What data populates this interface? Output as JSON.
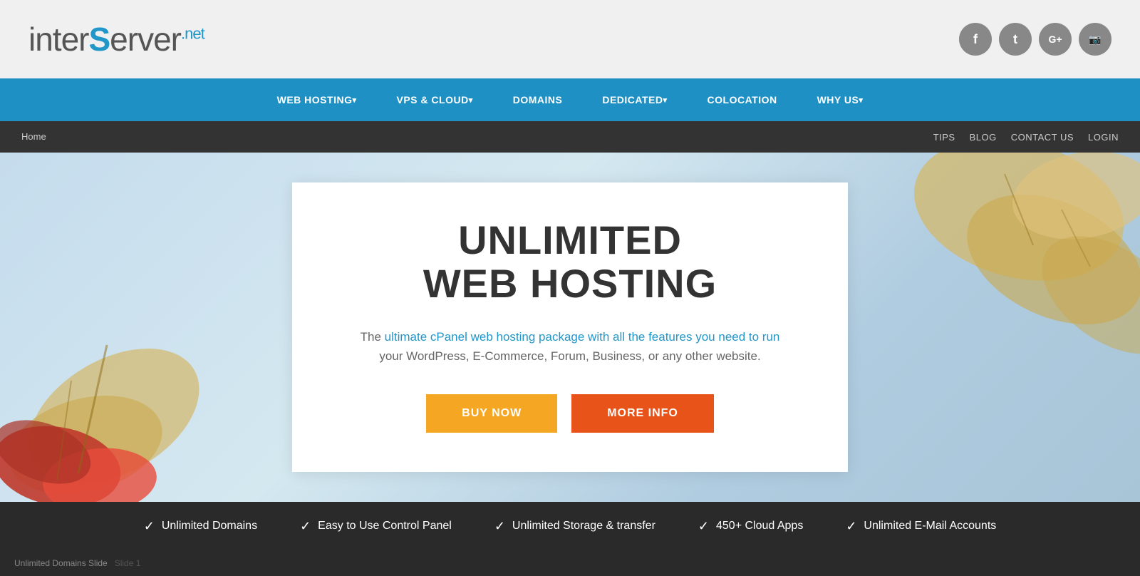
{
  "header": {
    "logo_inter": "inter",
    "logo_s": "S",
    "logo_erver": "erver",
    "logo_net": ".net"
  },
  "social": {
    "facebook": "f",
    "twitter": "t",
    "googleplus": "G+",
    "instagram": "📷"
  },
  "primary_nav": {
    "items": [
      {
        "label": "WEB HOSTING",
        "has_arrow": true
      },
      {
        "label": "VPS & CLOUD",
        "has_arrow": true
      },
      {
        "label": "DOMAINS",
        "has_arrow": false
      },
      {
        "label": "DEDICATED",
        "has_arrow": true
      },
      {
        "label": "COLOCATION",
        "has_arrow": false
      },
      {
        "label": "WHY US",
        "has_arrow": true
      }
    ]
  },
  "secondary_nav": {
    "home": "Home",
    "right_links": [
      "TIPS",
      "BLOG",
      "CONTACT US",
      "LOGIN"
    ]
  },
  "hero": {
    "title_line1": "UNLIMITED",
    "title_line2": "WEB HOSTING",
    "description": "The ultimate cPanel web hosting package with all the features you need to run your WordPress, E-Commerce, Forum, Business, or any other website.",
    "btn_buy": "BUY NOW",
    "btn_more": "MORE INFO"
  },
  "features": [
    {
      "check": "✓",
      "label": "Unlimited Domains"
    },
    {
      "check": "✓",
      "label": "Easy to Use Control Panel"
    },
    {
      "check": "✓",
      "label": "Unlimited Storage & transfer"
    },
    {
      "check": "✓",
      "label": "450+ Cloud Apps"
    },
    {
      "check": "✓",
      "label": "Unlimited E-Mail Accounts"
    }
  ],
  "slide": {
    "label": "Unlimited Domains Slide",
    "slide1": "Slide 1"
  }
}
